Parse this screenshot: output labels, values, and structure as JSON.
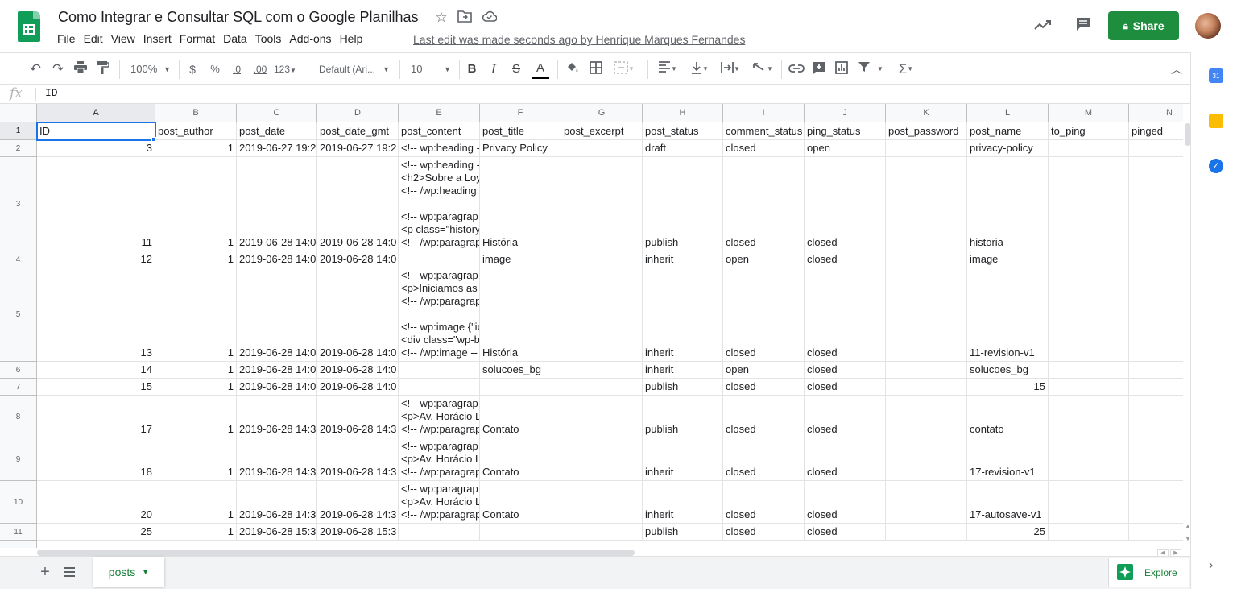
{
  "doc": {
    "title": "Como Integrar e Consultar SQL com o Google Planilhas",
    "last_edit": "Last edit was made seconds ago by Henrique Marques Fernandes"
  },
  "menu": [
    "File",
    "Edit",
    "View",
    "Insert",
    "Format",
    "Data",
    "Tools",
    "Add-ons",
    "Help"
  ],
  "share_label": "Share",
  "toolbar": {
    "zoom": "100%",
    "currency": "$",
    "percent": "%",
    "dec_less": ".0",
    "dec_more": ".00",
    "more_formats": "123",
    "font": "Default (Ari...",
    "font_size": "10",
    "bold": "B",
    "italic": "I",
    "strike": "S",
    "text_color": "A"
  },
  "formula": {
    "fx": "fx",
    "value": "ID"
  },
  "columns": [
    "A",
    "B",
    "C",
    "D",
    "E",
    "F",
    "G",
    "H",
    "I",
    "J",
    "K",
    "L",
    "M",
    "N"
  ],
  "rows": [
    {
      "n": "1",
      "cells": [
        "ID",
        "post_author",
        "post_date",
        "post_date_gmt",
        "post_content",
        "post_title",
        "post_excerpt",
        "post_status",
        "comment_status",
        "ping_status",
        "post_password",
        "post_name",
        "to_ping",
        "pinged"
      ]
    },
    {
      "n": "2",
      "cells": [
        "3",
        "1",
        "2019-06-27 19:2",
        "2019-06-27 19:2",
        "<!-- wp:heading -",
        "Privacy Policy",
        "",
        "draft",
        "closed",
        "open",
        "",
        "privacy-policy",
        "",
        ""
      ]
    },
    {
      "n": "3",
      "cells": [
        "11",
        "1",
        "2019-06-28 14:0",
        "2019-06-28 14:0",
        "<!-- wp:heading -\n<h2>Sobre a Loy\n<!-- /wp:heading\n\n<!-- wp:paragrap\n<p class=\"history\n<!-- /wp:paragrap",
        "História",
        "",
        "publish",
        "closed",
        "closed",
        "",
        "historia",
        "",
        ""
      ]
    },
    {
      "n": "4",
      "cells": [
        "12",
        "1",
        "2019-06-28 14:0",
        "2019-06-28 14:0",
        "",
        "image",
        "",
        "inherit",
        "open",
        "closed",
        "",
        "image",
        "",
        ""
      ]
    },
    {
      "n": "5",
      "cells": [
        "13",
        "1",
        "2019-06-28 14:0",
        "2019-06-28 14:0",
        "<!-- wp:paragrap\n<p>Iniciamos as\n<!-- /wp:paragrap\n\n<!-- wp:image {\"ic\n<div class=\"wp-b\n<!-- /wp:image --",
        "História",
        "",
        "inherit",
        "closed",
        "closed",
        "",
        "11-revision-v1",
        "",
        ""
      ]
    },
    {
      "n": "6",
      "cells": [
        "14",
        "1",
        "2019-06-28 14:0",
        "2019-06-28 14:0",
        "",
        "solucoes_bg",
        "",
        "inherit",
        "open",
        "closed",
        "",
        "solucoes_bg",
        "",
        ""
      ]
    },
    {
      "n": "7",
      "cells": [
        "15",
        "1",
        "2019-06-28 14:0",
        "2019-06-28 14:0",
        "",
        "",
        "",
        "publish",
        "closed",
        "closed",
        "",
        "15",
        "",
        ""
      ]
    },
    {
      "n": "8",
      "cells": [
        "17",
        "1",
        "2019-06-28 14:3",
        "2019-06-28 14:3",
        "<!-- wp:paragrap\n<p>Av. Horácio L\n<!-- /wp:paragrap",
        "Contato",
        "",
        "publish",
        "closed",
        "closed",
        "",
        "contato",
        "",
        ""
      ]
    },
    {
      "n": "9",
      "cells": [
        "18",
        "1",
        "2019-06-28 14:3",
        "2019-06-28 14:3",
        "<!-- wp:paragrap\n<p>Av. Horácio L\n<!-- /wp:paragrap",
        "Contato",
        "",
        "inherit",
        "closed",
        "closed",
        "",
        "17-revision-v1",
        "",
        ""
      ]
    },
    {
      "n": "10",
      "cells": [
        "20",
        "1",
        "2019-06-28 14:3",
        "2019-06-28 14:3",
        "<!-- wp:paragrap\n<p>Av. Horácio L\n<!-- /wp:paragrap",
        "Contato",
        "",
        "inherit",
        "closed",
        "closed",
        "",
        "17-autosave-v1",
        "",
        ""
      ]
    },
    {
      "n": "11",
      "cells": [
        "25",
        "1",
        "2019-06-28 15:3",
        "2019-06-28 15:3",
        "",
        "",
        "",
        "publish",
        "closed",
        "closed",
        "",
        "25",
        "",
        ""
      ]
    }
  ],
  "sheet_tab": "posts",
  "explore_label": "Explore",
  "colors": {
    "brand_green": "#1e8e3e",
    "selection": "#1a73e8"
  }
}
